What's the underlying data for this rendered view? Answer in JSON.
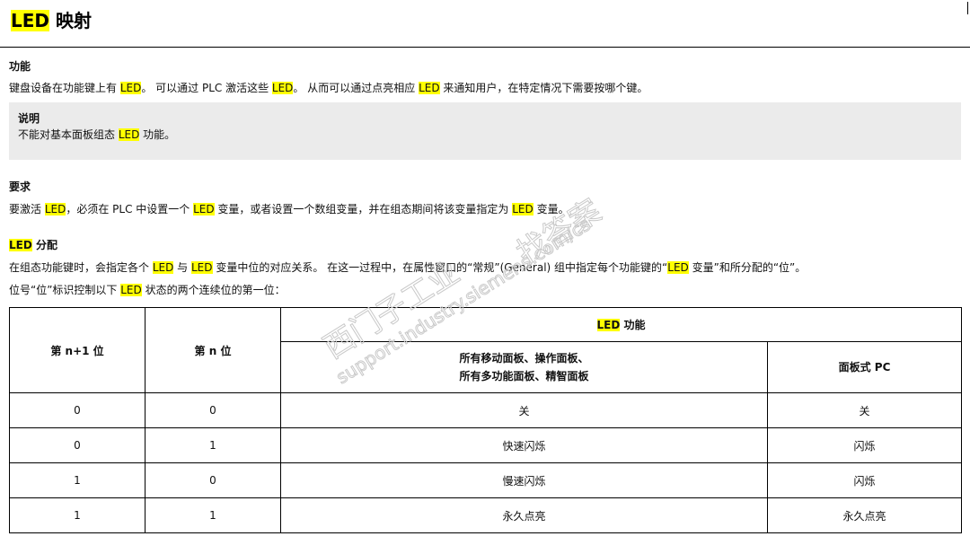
{
  "title": {
    "led": "LED",
    "rest": " 映射"
  },
  "function_section": {
    "heading": "功能",
    "line": [
      {
        "t": "键盘设备在功能键上有 "
      },
      {
        "t": "LED",
        "hl": true
      },
      {
        "t": "。 可以通过 PLC 激活这些 "
      },
      {
        "t": "LED",
        "hl": true
      },
      {
        "t": "。 从而可以通过点亮相应 "
      },
      {
        "t": "LED",
        "hl": true
      },
      {
        "t": " 来通知用户，在特定情况下需要按哪个键。"
      }
    ]
  },
  "note": {
    "title": "说明",
    "line": [
      {
        "t": "不能对基本面板组态 "
      },
      {
        "t": "LED",
        "hl": true
      },
      {
        "t": " 功能。"
      }
    ]
  },
  "requirement_section": {
    "heading": "要求",
    "line": [
      {
        "t": "要激活 "
      },
      {
        "t": "LED",
        "hl": true
      },
      {
        "t": "，必须在 PLC 中设置一个 "
      },
      {
        "t": "LED",
        "hl": true
      },
      {
        "t": " 变量，或者设置一个数组变量，并在组态期间将该变量指定为 "
      },
      {
        "t": "LED",
        "hl": true
      },
      {
        "t": " 变量。"
      }
    ]
  },
  "assign_section": {
    "heading": [
      {
        "t": "LED",
        "hl": true
      },
      {
        "t": " 分配"
      }
    ],
    "line1": [
      {
        "t": "在组态功能键时，会指定各个 "
      },
      {
        "t": "LED",
        "hl": true
      },
      {
        "t": " 与 "
      },
      {
        "t": "LED",
        "hl": true
      },
      {
        "t": " 变量中位的对应关系。 在这一过程中，在属性窗口的“常规”(General) 组中指定每个功能键的“"
      },
      {
        "t": "LED",
        "hl": true
      },
      {
        "t": " 变量”和所分配的“位”。"
      }
    ],
    "line2": [
      {
        "t": "位号“位”标识控制以下 "
      },
      {
        "t": "LED",
        "hl": true
      },
      {
        "t": " 状态的两个连续位的第一位："
      }
    ]
  },
  "table": {
    "col_bit_n1": "第 n+1 位",
    "col_bit_n": "第 n 位",
    "col_led_function": [
      {
        "t": "LED",
        "hl": true
      },
      {
        "t": " 功能"
      }
    ],
    "col_mobile_line1": "所有移动面板、操作面板、",
    "col_mobile_line2": "所有多功能面板、精智面板",
    "col_panel_pc": "面板式 PC",
    "rows": [
      {
        "n1": "0",
        "n": "0",
        "mobile": "关",
        "pc": "关"
      },
      {
        "n1": "0",
        "n": "1",
        "mobile": "快速闪烁",
        "pc": "闪烁"
      },
      {
        "n1": "1",
        "n": "0",
        "mobile": "慢速闪烁",
        "pc": "闪烁"
      },
      {
        "n1": "1",
        "n": "1",
        "mobile": "永久点亮",
        "pc": "永久点亮"
      }
    ]
  },
  "watermark": {
    "line1": "西门子工业",
    "line2": "support.industry.siemens.com/cs",
    "line3": "找答案"
  },
  "colors": {
    "highlight": "#ffff00",
    "note_bg": "#ebebeb",
    "text": "#111111"
  }
}
